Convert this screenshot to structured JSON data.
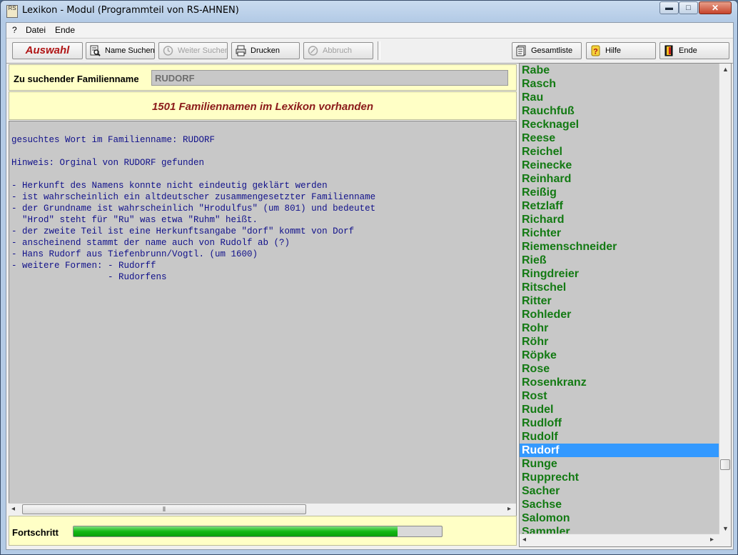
{
  "window": {
    "title": "Lexikon - Modul (Programmteil von RS-AHNEN)",
    "app_icon_text": "RS",
    "minimize_glyph": "▬",
    "maximize_glyph": "□",
    "close_glyph": "✕"
  },
  "menu": [
    "?",
    "Datei",
    "Ende"
  ],
  "toolbar": {
    "auswahl": "Auswahl",
    "name_suchen": "Name Suchen",
    "weiter_suchen": "Weiter Suchen",
    "drucken": "Drucken",
    "abbruch": "Abbruch",
    "gesamtliste": "Gesamtliste",
    "hilfe": "Hilfe",
    "ende": "Ende"
  },
  "search": {
    "label": "Zu suchender Familienname",
    "value": "RUDORF"
  },
  "count_text": "1501 Familiennamen im Lexikon vorhanden",
  "result_text": "gesuchtes Wort im Familienname: RUDORF\n\nHinweis: Orginal von RUDORF gefunden\n\n- Herkunft des Namens konnte nicht eindeutig geklärt werden\n- ist wahrscheinlich ein altdeutscher zusammengesetzter Familienname\n- der Grundname ist wahrscheinlich \"Hrodulfus\" (um 801) und bedeutet\n  \"Hrod\" steht für \"Ru\" was etwa \"Ruhm\" heißt.\n- der zweite Teil ist eine Herkunftsangabe \"dorf\" kommt von Dorf\n- anscheinend stammt der name auch von Rudolf ab (?)\n- Hans Rudorf aus Tiefenbrunn/Vogtl. (um 1600)\n- weitere Formen: - Rudorff\n                  - Rudorfens",
  "progress": {
    "label": "Fortschritt",
    "fraction": 0.88
  },
  "names": [
    "Rabe",
    "Rasch",
    "Rau",
    "Rauchfuß",
    "Recknagel",
    "Reese",
    "Reichel",
    "Reinecke",
    "Reinhard",
    "Reißig",
    "Retzlaff",
    "Richard",
    "Richter",
    "Riemenschneider",
    "Rieß",
    "Ringdreier",
    "Ritschel",
    "Ritter",
    "Rohleder",
    "Rohr",
    "Röhr",
    "Röpke",
    "Rose",
    "Rosenkranz",
    "Rost",
    "Rudel",
    "Rudloff",
    "Rudolf",
    "Rudorf",
    "Runge",
    "Rupprecht",
    "Sacher",
    "Sachse",
    "Salomon",
    "Sammler"
  ],
  "selected_name": "Rudorf",
  "colors": {
    "panel_yellow": "#ffffc6",
    "text_blue": "#10108a",
    "name_green": "#137a13",
    "selection": "#3399ff",
    "headline_red": "#8b1a1a",
    "auswahl_red": "#b01414",
    "progress_green": "#14b914"
  }
}
